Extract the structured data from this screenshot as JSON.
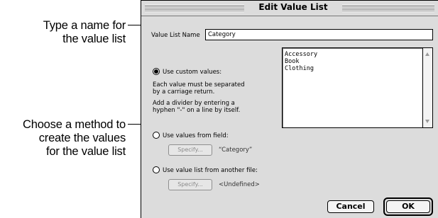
{
  "callouts": {
    "name_hint": [
      "Type a name for",
      "the value list"
    ],
    "method_hint": [
      "Choose a method to",
      "create the values",
      "for the value list"
    ]
  },
  "dialog": {
    "title": "Edit Value List",
    "value_list_name_label": "Value List Name",
    "value_list_name_value": "Category",
    "values": [
      "Accessory",
      "Book",
      "Clothing"
    ],
    "options": {
      "custom": {
        "label": "Use custom values:",
        "selected": true,
        "help1": [
          "Each value must be separated",
          "by a carriage return."
        ],
        "help2": [
          "Add a divider by entering a",
          "hyphen \"-\" on a line by itself."
        ]
      },
      "field": {
        "label": "Use values from field:",
        "selected": false,
        "specify_label": "Specify...",
        "current": "“Category”"
      },
      "file": {
        "label": "Use value list from another file:",
        "selected": false,
        "specify_label": "Specify...",
        "current": "<Undefined>"
      }
    },
    "cancel_label": "Cancel",
    "ok_label": "OK"
  }
}
